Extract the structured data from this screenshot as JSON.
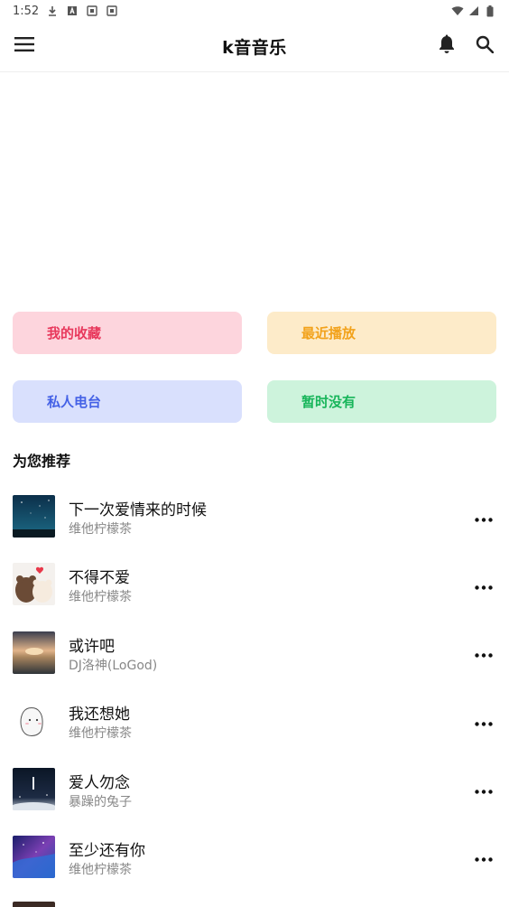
{
  "status_bar": {
    "time": "1:52",
    "left_icons": [
      "download-icon",
      "a-box-icon",
      "sim-icon",
      "sim-icon"
    ],
    "right_icons": [
      "wifi-icon",
      "signal-icon",
      "battery-icon"
    ]
  },
  "app_bar": {
    "title": "k音音乐",
    "menu_icon": "hamburger-menu-icon",
    "bell_icon": "bell-icon",
    "search_icon": "search-icon"
  },
  "quick_actions": [
    {
      "label": "我的收藏",
      "bg": "#fdd5dd",
      "color": "#e8385c"
    },
    {
      "label": "最近播放",
      "bg": "#fdebc9",
      "color": "#f2a21b"
    },
    {
      "label": "私人电台",
      "bg": "#d9e0fd",
      "color": "#4461e6"
    },
    {
      "label": "暂时没有",
      "bg": "#cdf3dc",
      "color": "#17b55a"
    }
  ],
  "recommend": {
    "title": "为您推荐",
    "songs": [
      {
        "title": "下一次爱情来的时候",
        "artist": "维他柠檬茶",
        "more_icon": "more-horizontal-icon"
      },
      {
        "title": "不得不爱",
        "artist": "维他柠檬茶",
        "more_icon": "more-horizontal-icon"
      },
      {
        "title": "或许吧",
        "artist": "DJ洛神(LoGod)",
        "more_icon": "more-horizontal-icon"
      },
      {
        "title": "我还想她",
        "artist": "维他柠檬茶",
        "more_icon": "more-horizontal-icon"
      },
      {
        "title": "爱人勿念",
        "artist": "暴躁的兔子",
        "more_icon": "more-horizontal-icon"
      },
      {
        "title": "至少还有你",
        "artist": "维他柠檬茶",
        "more_icon": "more-horizontal-icon"
      }
    ]
  }
}
